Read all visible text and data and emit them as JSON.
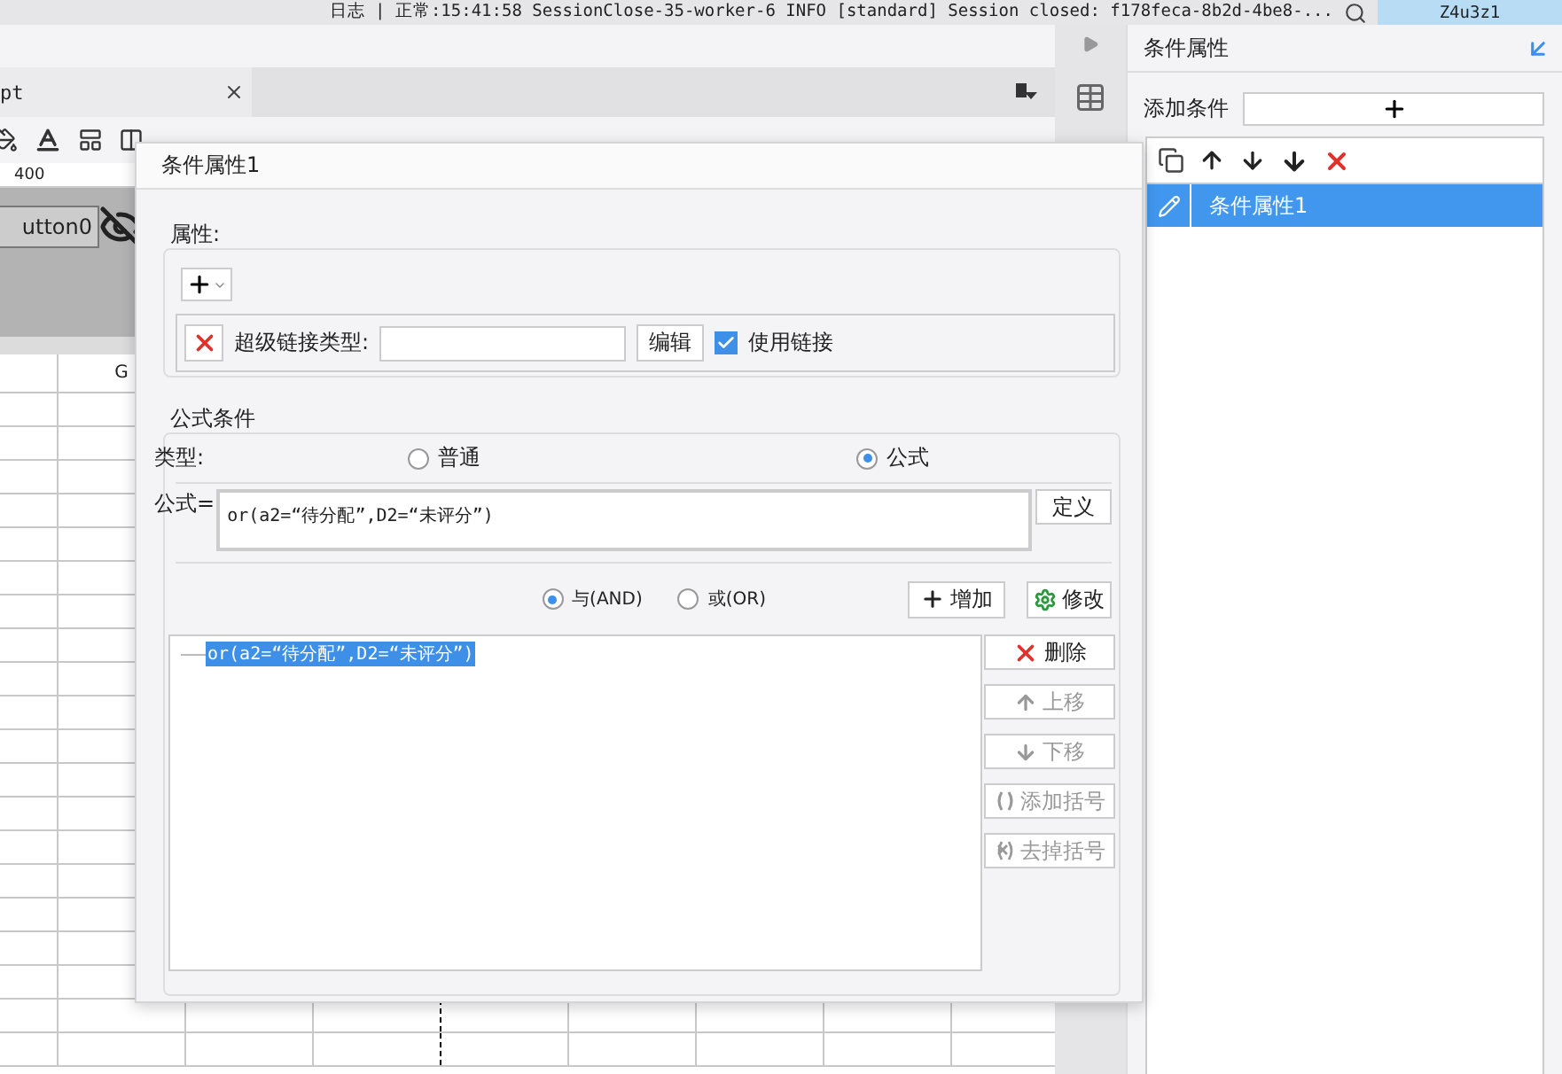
{
  "log_bar": {
    "text": "日志 | 正常:15:41:58 SessionClose-35-worker-6 INFO [standard] Session closed: f178feca-8b2d-4be8-...",
    "user": "Z4u3z1"
  },
  "editor": {
    "tab": {
      "label": "pt"
    },
    "ruler": {
      "label": "400"
    },
    "widget": {
      "label": "utton0"
    },
    "sheet": {
      "column_header": "G"
    }
  },
  "right_panel": {
    "title": "条件属性",
    "add_label": "添加条件",
    "items": [
      {
        "label": "条件属性1",
        "selected": true
      }
    ]
  },
  "dialog": {
    "title": "条件属性1",
    "attributes": {
      "legend": "属性:",
      "rows": [
        {
          "label": "超级链接类型:",
          "edit_button": "编辑",
          "use_link": {
            "label": "使用链接",
            "checked": true
          }
        }
      ]
    },
    "formula_section": {
      "legend": "公式条件",
      "type_label": "类型:",
      "types": [
        {
          "label": "普通",
          "selected": false
        },
        {
          "label": "公式",
          "selected": true
        }
      ],
      "formula_label": "公式=",
      "formula": "or(a2=“待分配”,D2=“未评分”)",
      "define_button": "定义",
      "joins": [
        {
          "label": "与(AND)",
          "selected": true
        },
        {
          "label": "或(OR)",
          "selected": false
        }
      ],
      "add_button": "增加",
      "modify_button": "修改",
      "conditions": [
        {
          "label": "or(a2=“待分配”,D2=“未评分”)",
          "selected": true
        }
      ],
      "actions": [
        {
          "kind": "delete",
          "label": "删除",
          "disabled": false
        },
        {
          "kind": "up",
          "label": "上移",
          "disabled": true
        },
        {
          "kind": "down",
          "label": "下移",
          "disabled": true
        },
        {
          "kind": "add_bracket",
          "label": "添加括号",
          "disabled": true
        },
        {
          "kind": "remove_bracket",
          "label": "去掉括号",
          "disabled": true
        }
      ]
    }
  }
}
